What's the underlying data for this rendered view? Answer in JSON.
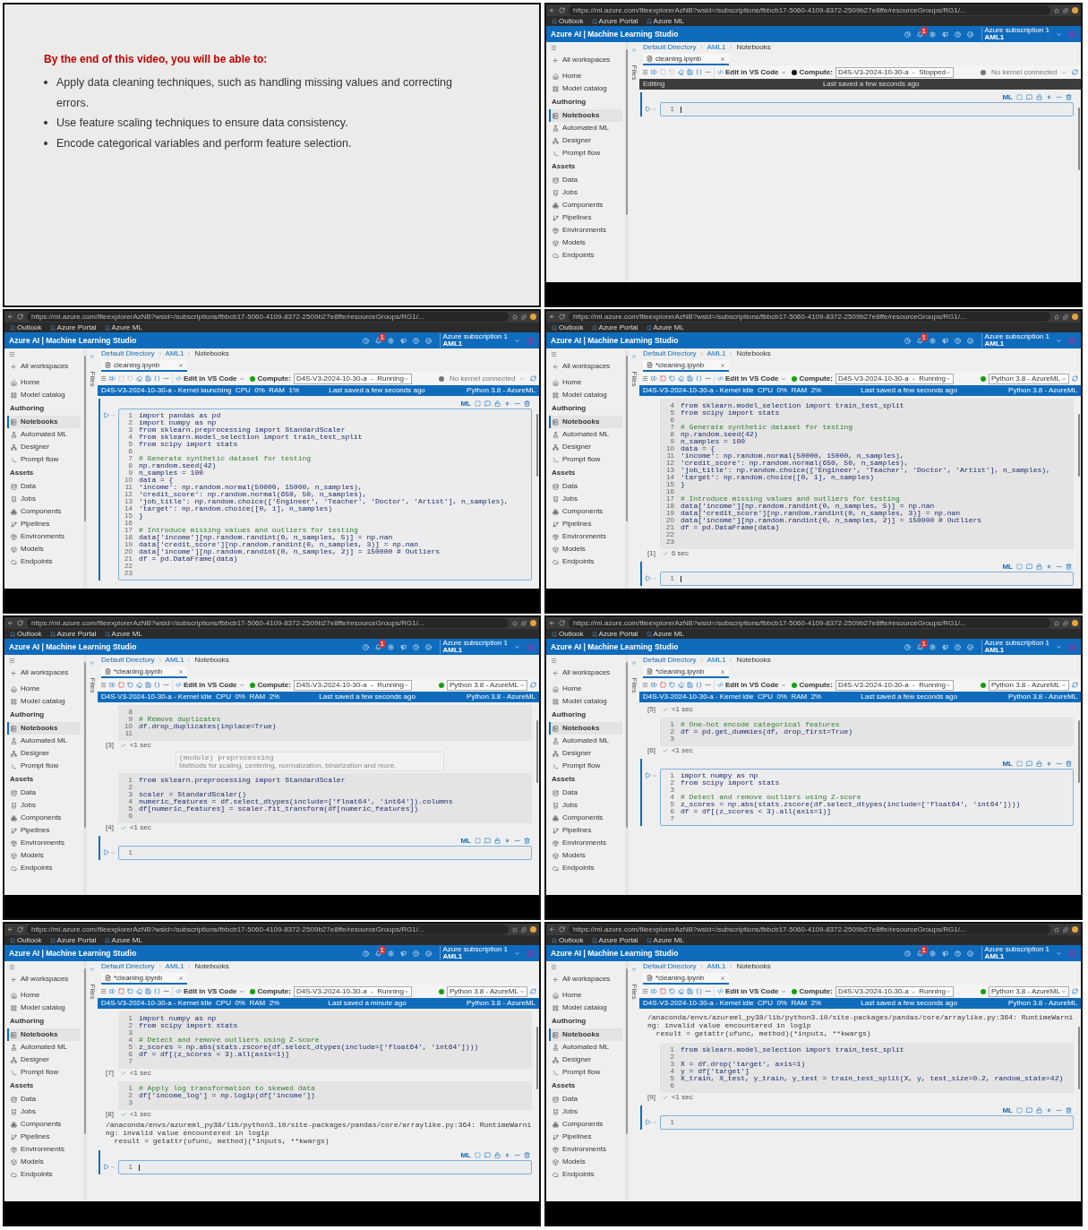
{
  "slide": {
    "heading": "By the end of this video, you will be able to:",
    "bullets": [
      "Apply data cleaning techniques, such as handling missing values and correcting errors.",
      "Use feature scaling techniques to ensure data consistency.",
      "Encode categorical variables and perform feature selection."
    ]
  },
  "screens": [
    {
      "browser": {
        "url": "https://ml.azure.com/fileexplorerAzNB?wsid=/subscriptions/fbbcb17-5060-4109-8372-2509b27e8ffe/resourceGroups/RG1/...",
        "bookmarks": [
          "Outlook",
          "Azure Portal",
          "Azure ML"
        ]
      },
      "header": {
        "title": "Azure AI | Machine Learning Studio",
        "notifications": "1",
        "subscription": "Azure subscription 1",
        "workspace": "AML1"
      },
      "sidebar": [
        {
          "kind": "back",
          "label": "All workspaces"
        },
        {
          "kind": "item",
          "label": "Home",
          "selected": false
        },
        {
          "kind": "item",
          "label": "Model catalog",
          "selected": false
        },
        {
          "kind": "section",
          "label": "Authoring"
        },
        {
          "kind": "item",
          "label": "Notebooks",
          "selected": true
        },
        {
          "kind": "item",
          "label": "Automated ML",
          "selected": false
        },
        {
          "kind": "item",
          "label": "Designer",
          "selected": false
        },
        {
          "kind": "item",
          "label": "Prompt flow",
          "selected": false
        },
        {
          "kind": "section",
          "label": "Assets"
        },
        {
          "kind": "item",
          "label": "Data",
          "selected": false
        },
        {
          "kind": "item",
          "label": "Jobs",
          "selected": false
        },
        {
          "kind": "item",
          "label": "Components",
          "selected": false
        },
        {
          "kind": "item",
          "label": "Pipelines",
          "selected": false
        },
        {
          "kind": "item",
          "label": "Environments",
          "selected": false
        },
        {
          "kind": "item",
          "label": "Models",
          "selected": false
        },
        {
          "kind": "item",
          "label": "Endpoints",
          "selected": false
        }
      ],
      "files_label": "Files",
      "breadcrumb": [
        "Default Directory",
        "AML1",
        "Notebooks"
      ],
      "tab": {
        "title": "cleaning.ipynb"
      },
      "toolbar": {
        "edit": "Edit in VS Code",
        "compute_label": "Compute:",
        "compute": "D4S-V3-2024-10-30-a  -  Stopped",
        "compute_running": false,
        "kernel": "No kernel connected",
        "kernel_connected": false
      },
      "status": {
        "kind": "editing",
        "left": "Editing",
        "saved": "Last saved a few seconds ago"
      },
      "cells": [
        {
          "active": true,
          "cursor": true,
          "toolbar_label": "ML",
          "lines": [
            {
              "n": "1"
            }
          ]
        }
      ]
    },
    {
      "browser": {
        "url": "https://ml.azure.com/fileexplorerAzNB?wsid=/subscriptions/fbbcb17-5060-4109-8372-2509b27e8ffe/resourceGroups/RG1/...",
        "bookmarks": [
          "Outlook",
          "Azure Portal",
          "Azure ML"
        ]
      },
      "header": {
        "title": "Azure AI | Machine Learning Studio",
        "notifications": "1",
        "subscription": "Azure subscription 1",
        "workspace": "AML1"
      },
      "sidebar": [
        {
          "kind": "back",
          "label": "All workspaces"
        },
        {
          "kind": "item",
          "label": "Home",
          "selected": false
        },
        {
          "kind": "item",
          "label": "Model catalog",
          "selected": false
        },
        {
          "kind": "section",
          "label": "Authoring"
        },
        {
          "kind": "item",
          "label": "Notebooks",
          "selected": true
        },
        {
          "kind": "item",
          "label": "Automated ML",
          "selected": false
        },
        {
          "kind": "item",
          "label": "Designer",
          "selected": false
        },
        {
          "kind": "item",
          "label": "Prompt flow",
          "selected": false
        },
        {
          "kind": "section",
          "label": "Assets"
        },
        {
          "kind": "item",
          "label": "Data",
          "selected": false
        },
        {
          "kind": "item",
          "label": "Jobs",
          "selected": false
        },
        {
          "kind": "item",
          "label": "Components",
          "selected": false
        },
        {
          "kind": "item",
          "label": "Pipelines",
          "selected": false
        },
        {
          "kind": "item",
          "label": "Environments",
          "selected": false
        },
        {
          "kind": "item",
          "label": "Models",
          "selected": false
        },
        {
          "kind": "item",
          "label": "Endpoints",
          "selected": false
        }
      ],
      "files_label": "Files",
      "breadcrumb": [
        "Default Directory",
        "AML1",
        "Notebooks"
      ],
      "tab": {
        "title": "cleaning.ipynb"
      },
      "toolbar": {
        "edit": "Edit in VS Code",
        "compute_label": "Compute:",
        "compute": "D4S-V3-2024-10-30-a  -  Running",
        "compute_running": true,
        "kernel": "No kernel connected",
        "kernel_connected": false
      },
      "status": {
        "kind": "kernel",
        "left": "D4S-V3-2024-10-30-a - Kernel launching  CPU  0%  RAM  1%",
        "saved": "Last saved a few seconds ago",
        "right": "Python 3.8 - AzureML"
      },
      "cells": [
        {
          "active": true,
          "cursor": false,
          "toolbar_label": "ML",
          "lines": [
            {
              "n": "1",
              "code": "import pandas as pd"
            },
            {
              "n": "2",
              "code": "import numpy as np"
            },
            {
              "n": "3",
              "code": "from sklearn.preprocessing import StandardScaler"
            },
            {
              "n": "4",
              "code": "from sklearn.model_selection import train_test_split"
            },
            {
              "n": "5",
              "code": "from scipy import stats"
            },
            {
              "n": "6"
            },
            {
              "n": "7",
              "code": "# Generate synthetic dataset for testing",
              "comment": true
            },
            {
              "n": "8",
              "code": "np.random.seed(42)"
            },
            {
              "n": "9",
              "code": "n_samples = 100"
            },
            {
              "n": "10",
              "code": "data = {"
            },
            {
              "n": "11",
              "code": "'income': np.random.normal(50000, 15000, n_samples),"
            },
            {
              "n": "12",
              "code": "'credit_score': np.random.normal(650, 50, n_samples),"
            },
            {
              "n": "13",
              "code": "'job_title': np.random.choice(['Engineer', 'Teacher', 'Doctor', 'Artist'], n_samples),"
            },
            {
              "n": "14",
              "code": "'target': np.random.choice([0, 1], n_samples)"
            },
            {
              "n": "15",
              "code": "}"
            },
            {
              "n": "16"
            },
            {
              "n": "17",
              "code": "# Introduce missing values and outliers for testing",
              "comment": true
            },
            {
              "n": "18",
              "code": "data['income'][np.random.randint(0, n_samples, 5)] = np.nan"
            },
            {
              "n": "19",
              "code": "data['credit_score'][np.random.randint(0, n_samples, 3)] = np.nan"
            },
            {
              "n": "20",
              "code": "data['income'][np.random.randint(0, n_samples, 2)] = 150000 # Outliers"
            },
            {
              "n": "21",
              "code": "df = pd.DataFrame(data)"
            },
            {
              "n": "22"
            },
            {
              "n": "23"
            }
          ]
        }
      ]
    },
    {
      "browser": {
        "url": "https://ml.azure.com/fileexplorerAzNB?wsid=/subscriptions/fbbcb17-5060-4109-8372-2509b27e8ffe/resourceGroups/RG1/...",
        "bookmarks": [
          "Outlook",
          "Azure Portal",
          "Azure ML"
        ]
      },
      "header": {
        "title": "Azure AI | Machine Learning Studio",
        "notifications": "1",
        "subscription": "Azure subscription 1",
        "workspace": "AML1"
      },
      "sidebar": [
        {
          "kind": "back",
          "label": "All workspaces"
        },
        {
          "kind": "item",
          "label": "Home",
          "selected": false
        },
        {
          "kind": "item",
          "label": "Model catalog",
          "selected": false
        },
        {
          "kind": "section",
          "label": "Authoring"
        },
        {
          "kind": "item",
          "label": "Notebooks",
          "selected": true
        },
        {
          "kind": "item",
          "label": "Automated ML",
          "selected": false
        },
        {
          "kind": "item",
          "label": "Designer",
          "selected": false
        },
        {
          "kind": "item",
          "label": "Prompt flow",
          "selected": false
        },
        {
          "kind": "section",
          "label": "Assets"
        },
        {
          "kind": "item",
          "label": "Data",
          "selected": false
        },
        {
          "kind": "item",
          "label": "Jobs",
          "selected": false
        },
        {
          "kind": "item",
          "label": "Components",
          "selected": false
        },
        {
          "kind": "item",
          "label": "Pipelines",
          "selected": false
        },
        {
          "kind": "item",
          "label": "Environments",
          "selected": false
        },
        {
          "kind": "item",
          "label": "Models",
          "selected": false
        },
        {
          "kind": "item",
          "label": "Endpoints",
          "selected": false
        }
      ],
      "files_label": "Files",
      "breadcrumb": [
        "Default Directory",
        "AML1",
        "Notebooks"
      ],
      "tab": {
        "title": "*cleaning.ipynb"
      },
      "toolbar": {
        "edit": "Edit in VS Code",
        "compute_label": "Compute:",
        "compute": "D4S-V3-2024-10-30-a  -  Running",
        "compute_running": true,
        "kernel": "Python 3.8 - AzureML",
        "kernel_connected": true
      },
      "status": {
        "kind": "kernel",
        "left": "D4S-V3-2024-10-30-a - Kernel idle  CPU  0%  RAM  2%",
        "saved": "Last saved a few seconds ago",
        "right": "Python 3.8 - AzureML"
      },
      "cells": [
        {
          "active": false,
          "exec": "[1]",
          "time": "6 sec",
          "lines": [
            {
              "n": "4",
              "code": "from sklearn.model_selection import train_test_split"
            },
            {
              "n": "5",
              "code": "from scipy import stats"
            },
            {
              "n": "6"
            },
            {
              "n": "7",
              "code": "# Generate synthetic dataset for testing",
              "comment": true
            },
            {
              "n": "8",
              "code": "np.random.seed(42)"
            },
            {
              "n": "9",
              "code": "n_samples = 100"
            },
            {
              "n": "10",
              "code": "data = {"
            },
            {
              "n": "11",
              "code": "'income': np.random.normal(50000, 15000, n_samples),"
            },
            {
              "n": "12",
              "code": "'credit_score': np.random.normal(650, 50, n_samples),"
            },
            {
              "n": "13",
              "code": "'job_title': np.random.choice(['Engineer', 'Teacher', 'Doctor', 'Artist'], n_samples),"
            },
            {
              "n": "14",
              "code": "'target': np.random.choice([0, 1], n_samples)"
            },
            {
              "n": "15",
              "code": "}"
            },
            {
              "n": "16"
            },
            {
              "n": "17",
              "code": "# Introduce missing values and outliers for testing",
              "comment": true
            },
            {
              "n": "18",
              "code": "data['income'][np.random.randint(0, n_samples, 5)] = np.nan"
            },
            {
              "n": "19",
              "code": "data['credit_score'][np.random.randint(0, n_samples, 3)] = np.nan"
            },
            {
              "n": "20",
              "code": "data['income'][np.random.randint(0, n_samples, 2)] = 150000 # Outliers"
            },
            {
              "n": "21",
              "code": "df = pd.DataFrame(data)"
            },
            {
              "n": "22"
            },
            {
              "n": "23"
            }
          ]
        },
        {
          "active": true,
          "cursor": true,
          "toolbar_label": "ML",
          "lines": [
            {
              "n": "1"
            }
          ]
        }
      ]
    },
    {
      "browser": {
        "url": "https://ml.azure.com/fileexplorerAzNB?wsid=/subscriptions/fbbcb17-5060-4109-8372-2509b27e8ffe/resourceGroups/RG1/...",
        "bookmarks": [
          "Outlook",
          "Azure Portal",
          "Azure ML"
        ]
      },
      "header": {
        "title": "Azure AI | Machine Learning Studio",
        "notifications": "1",
        "subscription": "Azure subscription 1",
        "workspace": "AML1"
      },
      "sidebar": [
        {
          "kind": "back",
          "label": "All workspaces"
        },
        {
          "kind": "item",
          "label": "Home",
          "selected": false
        },
        {
          "kind": "item",
          "label": "Model catalog",
          "selected": false
        },
        {
          "kind": "section",
          "label": "Authoring"
        },
        {
          "kind": "item",
          "label": "Notebooks",
          "selected": true
        },
        {
          "kind": "item",
          "label": "Automated ML",
          "selected": false
        },
        {
          "kind": "item",
          "label": "Designer",
          "selected": false
        },
        {
          "kind": "item",
          "label": "Prompt flow",
          "selected": false
        },
        {
          "kind": "section",
          "label": "Assets"
        },
        {
          "kind": "item",
          "label": "Data",
          "selected": false
        },
        {
          "kind": "item",
          "label": "Jobs",
          "selected": false
        },
        {
          "kind": "item",
          "label": "Components",
          "selected": false
        },
        {
          "kind": "item",
          "label": "Pipelines",
          "selected": false
        },
        {
          "kind": "item",
          "label": "Environments",
          "selected": false
        },
        {
          "kind": "item",
          "label": "Models",
          "selected": false
        },
        {
          "kind": "item",
          "label": "Endpoints",
          "selected": false
        }
      ],
      "files_label": "Files",
      "breadcrumb": [
        "Default Directory",
        "AML1",
        "Notebooks"
      ],
      "tab": {
        "title": "*cleaning.ipynb"
      },
      "toolbar": {
        "edit": "Edit in VS Code",
        "compute_label": "Compute:",
        "compute": "D4S-V3-2024-10-30-a  -  Running",
        "compute_running": true,
        "kernel": "Python 3.8 - AzureML",
        "kernel_connected": true
      },
      "status": {
        "kind": "kernel",
        "left": "D4S-V3-2024-10-30-a - Kernel idle  CPU  0%  RAM  2%",
        "saved": "Last saved a few seconds ago",
        "right": "Python 3.8 - AzureML"
      },
      "tooltip": {
        "title": "(module) preprocessing",
        "text": "Methods for scaling, centering, normalization, binarization and more."
      },
      "cells": [
        {
          "active": false,
          "exec": "[3]",
          "time": "<1 sec",
          "lines": [
            {
              "n": "8"
            },
            {
              "n": "9",
              "code": "# Remove duplicates",
              "comment": true
            },
            {
              "n": "10",
              "code": "df.drop_duplicates(inplace=True)"
            },
            {
              "n": "11"
            }
          ]
        },
        {
          "active": false,
          "exec": "[4]",
          "time": "<1 sec",
          "lines": [
            {
              "n": "1",
              "code": "from sklearn.preprocessing import StandardScaler"
            },
            {
              "n": "2"
            },
            {
              "n": "3",
              "code": "scaler = StandardScaler()"
            },
            {
              "n": "4",
              "code": "numeric_features = df.select_dtypes(include=['float64', 'int64']).columns"
            },
            {
              "n": "5",
              "code": "df[numeric_features] = scaler.fit_transform(df[numeric_features])"
            },
            {
              "n": "6"
            }
          ]
        },
        {
          "active": true,
          "cursor": false,
          "toolbar_label": "ML",
          "lines": [
            {
              "n": "1"
            }
          ]
        }
      ]
    },
    {
      "browser": {
        "url": "https://ml.azure.com/fileexplorerAzNB?wsid=/subscriptions/fbbcb17-5060-4109-8372-2509b27e8ffe/resourceGroups/RG1/...",
        "bookmarks": [
          "Outlook",
          "Azure Portal",
          "Azure ML"
        ]
      },
      "header": {
        "title": "Azure AI | Machine Learning Studio",
        "notifications": "1",
        "subscription": "Azure subscription 1",
        "workspace": "AML1"
      },
      "sidebar": [
        {
          "kind": "back",
          "label": "All workspaces"
        },
        {
          "kind": "item",
          "label": "Home",
          "selected": false
        },
        {
          "kind": "item",
          "label": "Model catalog",
          "selected": false
        },
        {
          "kind": "section",
          "label": "Authoring"
        },
        {
          "kind": "item",
          "label": "Notebooks",
          "selected": true
        },
        {
          "kind": "item",
          "label": "Automated ML",
          "selected": false
        },
        {
          "kind": "item",
          "label": "Designer",
          "selected": false
        },
        {
          "kind": "item",
          "label": "Prompt flow",
          "selected": false
        },
        {
          "kind": "section",
          "label": "Assets"
        },
        {
          "kind": "item",
          "label": "Data",
          "selected": false
        },
        {
          "kind": "item",
          "label": "Jobs",
          "selected": false
        },
        {
          "kind": "item",
          "label": "Components",
          "selected": false
        },
        {
          "kind": "item",
          "label": "Pipelines",
          "selected": false
        },
        {
          "kind": "item",
          "label": "Environments",
          "selected": false
        },
        {
          "kind": "item",
          "label": "Models",
          "selected": false
        },
        {
          "kind": "item",
          "label": "Endpoints",
          "selected": false
        }
      ],
      "files_label": "Files",
      "breadcrumb": [
        "Default Directory",
        "AML1",
        "Notebooks"
      ],
      "tab": {
        "title": "*cleaning.ipynb"
      },
      "toolbar": {
        "edit": "Edit in VS Code",
        "compute_label": "Compute:",
        "compute": "D4S-V3-2024-10-30-a  -  Running",
        "compute_running": true,
        "kernel": "Python 3.8 - AzureML",
        "kernel_connected": true
      },
      "status": {
        "kind": "kernel",
        "left": "D4S-V3-2024-10-30-a - Kernel idle  CPU  0%  RAM  2%",
        "saved": "Last saved a few seconds ago",
        "right": "Python 3.8 - AzureML"
      },
      "cells": [
        {
          "active": false,
          "exec": "[5]",
          "time": "<1 sec"
        },
        {
          "active": false,
          "exec": "[6]",
          "time": "<1 sec",
          "lines": [
            {
              "n": "1",
              "code": "# One-hot encode categorical features",
              "comment": true
            },
            {
              "n": "2",
              "code": "df = pd.get_dummies(df, drop_first=True)"
            },
            {
              "n": "3"
            }
          ]
        },
        {
          "active": true,
          "cursor": false,
          "toolbar_label": "ML",
          "lines": [
            {
              "n": "1",
              "code": "import numpy as np"
            },
            {
              "n": "2",
              "code": "from scipy import stats"
            },
            {
              "n": "3"
            },
            {
              "n": "4",
              "code": "# Detect and remove outliers using Z-score",
              "comment": true
            },
            {
              "n": "5",
              "code": "z_scores = np.abs(stats.zscore(df.select_dtypes(include=['float64', 'int64'])))"
            },
            {
              "n": "6",
              "code": "df = df[(z_scores < 3).all(axis=1)]"
            },
            {
              "n": "7"
            }
          ]
        }
      ]
    },
    {
      "browser": {
        "url": "https://ml.azure.com/fileexplorerAzNB?wsid=/subscriptions/fbbcb17-5060-4109-8372-2509b27e8ffe/resourceGroups/RG1/...",
        "bookmarks": [
          "Outlook",
          "Azure Portal",
          "Azure ML"
        ]
      },
      "header": {
        "title": "Azure AI | Machine Learning Studio",
        "notifications": "1",
        "subscription": "Azure subscription 1",
        "workspace": "AML1"
      },
      "sidebar": [
        {
          "kind": "back",
          "label": "All workspaces"
        },
        {
          "kind": "item",
          "label": "Home",
          "selected": false
        },
        {
          "kind": "item",
          "label": "Model catalog",
          "selected": false
        },
        {
          "kind": "section",
          "label": "Authoring"
        },
        {
          "kind": "item",
          "label": "Notebooks",
          "selected": true
        },
        {
          "kind": "item",
          "label": "Automated ML",
          "selected": false
        },
        {
          "kind": "item",
          "label": "Designer",
          "selected": false
        },
        {
          "kind": "item",
          "label": "Prompt flow",
          "selected": false
        },
        {
          "kind": "section",
          "label": "Assets"
        },
        {
          "kind": "item",
          "label": "Data",
          "selected": false
        },
        {
          "kind": "item",
          "label": "Jobs",
          "selected": false
        },
        {
          "kind": "item",
          "label": "Components",
          "selected": false
        },
        {
          "kind": "item",
          "label": "Pipelines",
          "selected": false
        },
        {
          "kind": "item",
          "label": "Environments",
          "selected": false
        },
        {
          "kind": "item",
          "label": "Models",
          "selected": false
        },
        {
          "kind": "item",
          "label": "Endpoints",
          "selected": false
        }
      ],
      "files_label": "Files",
      "breadcrumb": [
        "Default Directory",
        "AML1",
        "Notebooks"
      ],
      "tab": {
        "title": "*cleaning.ipynb"
      },
      "toolbar": {
        "edit": "Edit in VS Code",
        "compute_label": "Compute:",
        "compute": "D4S-V3-2024-10-30-a  -  Running",
        "compute_running": true,
        "kernel": "Python 3.8 - AzureML",
        "kernel_connected": true
      },
      "status": {
        "kind": "kernel",
        "left": "D4S-V3-2024-10-30-a - Kernel idle  CPU  0%  RAM  2%",
        "saved": "Last saved a minute ago",
        "right": "Python 3.8 - AzureML"
      },
      "cells": [
        {
          "active": false,
          "exec": "[7]",
          "time": "<1 sec",
          "lines": [
            {
              "n": "1",
              "code": "import numpy as np"
            },
            {
              "n": "2",
              "code": "from scipy import stats"
            },
            {
              "n": "3"
            },
            {
              "n": "4",
              "code": "# Detect and remove outliers using Z-score",
              "comment": true
            },
            {
              "n": "5",
              "code": "z_scores = np.abs(stats.zscore(df.select_dtypes(include=['float64', 'int64'])))"
            },
            {
              "n": "6",
              "code": "df = df[(z_scores < 3).all(axis=1)]"
            },
            {
              "n": "7"
            }
          ]
        },
        {
          "active": false,
          "exec": "[8]",
          "time": "<1 sec",
          "lines": [
            {
              "n": "1",
              "code": "# Apply log transformation to skewed data",
              "comment": true
            },
            {
              "n": "2",
              "code": "df['income_log'] = np.log1p(df['income'])"
            },
            {
              "n": "3"
            }
          ],
          "output": [
            "/anaconda/envs/azureml_py38/lib/python3.10/site-packages/pandas/core/arraylike.py:364: RuntimeWarning: invalid value encountered in log1p",
            "  result = getattr(ufunc, method)(*inputs, **kwargs)"
          ]
        },
        {
          "active": true,
          "cursor": true,
          "toolbar_label": "ML",
          "lines": [
            {
              "n": "1"
            }
          ]
        }
      ]
    },
    {
      "browser": {
        "url": "https://ml.azure.com/fileexplorerAzNB?wsid=/subscriptions/fbbcb17-5060-4109-8372-2509b27e8ffe/resourceGroups/RG1/...",
        "bookmarks": [
          "Outlook",
          "Azure Portal",
          "Azure ML"
        ]
      },
      "header": {
        "title": "Azure AI | Machine Learning Studio",
        "notifications": "1",
        "subscription": "Azure subscription 1",
        "workspace": "AML1"
      },
      "sidebar": [
        {
          "kind": "back",
          "label": "All workspaces"
        },
        {
          "kind": "item",
          "label": "Home",
          "selected": false
        },
        {
          "kind": "item",
          "label": "Model catalog",
          "selected": false
        },
        {
          "kind": "section",
          "label": "Authoring"
        },
        {
          "kind": "item",
          "label": "Notebooks",
          "selected": true
        },
        {
          "kind": "item",
          "label": "Automated ML",
          "selected": false
        },
        {
          "kind": "item",
          "label": "Designer",
          "selected": false
        },
        {
          "kind": "item",
          "label": "Prompt flow",
          "selected": false
        },
        {
          "kind": "section",
          "label": "Assets"
        },
        {
          "kind": "item",
          "label": "Data",
          "selected": false
        },
        {
          "kind": "item",
          "label": "Jobs",
          "selected": false
        },
        {
          "kind": "item",
          "label": "Components",
          "selected": false
        },
        {
          "kind": "item",
          "label": "Pipelines",
          "selected": false
        },
        {
          "kind": "item",
          "label": "Environments",
          "selected": false
        },
        {
          "kind": "item",
          "label": "Models",
          "selected": false
        },
        {
          "kind": "item",
          "label": "Endpoints",
          "selected": false
        }
      ],
      "files_label": "Files",
      "breadcrumb": [
        "Default Directory",
        "AML1",
        "Notebooks"
      ],
      "tab": {
        "title": "*cleaning.ipynb"
      },
      "toolbar": {
        "edit": "Edit in VS Code",
        "compute_label": "Compute:",
        "compute": "D4S-V3-2024-10-30-a  -  Running",
        "compute_running": true,
        "kernel": "Python 3.8 - AzureML",
        "kernel_connected": true
      },
      "status": {
        "kind": "kernel",
        "left": "D4S-V3-2024-10-30-a - Kernel idle  CPU  0%  RAM  2%",
        "saved": "Last saved a few seconds ago",
        "right": "Python 3.8 - AzureML"
      },
      "cells": [
        {
          "active": false,
          "output": [
            "/anaconda/envs/azureml_py38/lib/python3.10/site-packages/pandas/core/arraylike.py:364: RuntimeWarning: invalid value encountered in log1p",
            "  result = getattr(ufunc, method)(*inputs, **kwargs)"
          ]
        },
        {
          "active": false,
          "exec": "[9]",
          "time": "<1 sec",
          "lines": [
            {
              "n": "1",
              "code": "from sklearn.model_selection import train_test_split"
            },
            {
              "n": "2"
            },
            {
              "n": "3",
              "code": "X = df.drop('target', axis=1)"
            },
            {
              "n": "4",
              "code": "y = df['target']"
            },
            {
              "n": "5",
              "code": "X_train, X_test, y_train, y_test = train_test_split(X, y, test_size=0.2, random_state=42)"
            },
            {
              "n": "6"
            }
          ]
        },
        {
          "active": true,
          "cursor": false,
          "toolbar_label": "ML",
          "lines": [
            {
              "n": "1"
            }
          ]
        }
      ]
    }
  ]
}
